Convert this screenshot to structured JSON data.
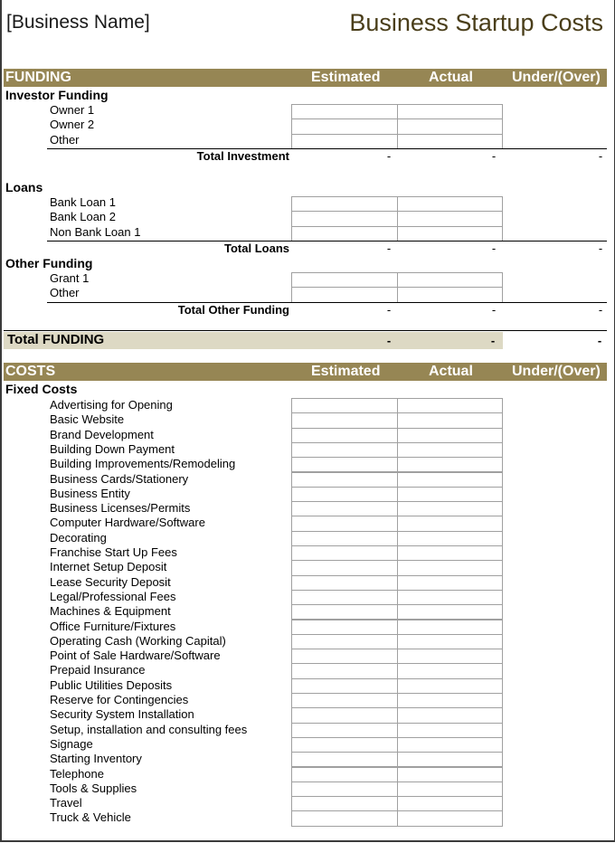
{
  "header": {
    "business_name": "[Business Name]",
    "title": "Business Startup Costs"
  },
  "columns": {
    "estimated": "Estimated",
    "actual": "Actual",
    "under_over": "Under/(Over)"
  },
  "colors": {
    "header_bar": "#968654",
    "total_band": "#ddd9c4",
    "title_text": "#4a3e1a"
  },
  "funding": {
    "section_label": "FUNDING",
    "groups": [
      {
        "label": "Investor Funding",
        "items": [
          "Owner 1",
          "Owner 2",
          "Other"
        ],
        "total_label": "Total Investment",
        "total_values": [
          "-",
          "-",
          "-"
        ]
      },
      {
        "label": "Loans",
        "items": [
          "Bank Loan 1",
          "Bank Loan 2",
          "Non Bank Loan 1"
        ],
        "total_label": "Total Loans",
        "total_values": [
          "-",
          "-",
          "-"
        ]
      },
      {
        "label": "Other Funding",
        "items": [
          "Grant 1",
          "Other"
        ],
        "total_label": "Total Other Funding",
        "total_values": [
          "-",
          "-",
          "-"
        ]
      }
    ],
    "grand_total_label": "Total FUNDING",
    "grand_total_values": [
      "-",
      "-",
      "-"
    ]
  },
  "costs": {
    "section_label": "COSTS",
    "groups": [
      {
        "label": "Fixed Costs",
        "items": [
          "Advertising for Opening",
          "Basic Website",
          "Brand Development",
          "Building Down Payment",
          "Building Improvements/Remodeling",
          "Business Cards/Stationery",
          "Business Entity",
          "Business Licenses/Permits",
          "Computer Hardware/Software",
          "Decorating",
          "Franchise Start Up Fees",
          "Internet Setup Deposit",
          "Lease Security Deposit",
          "Legal/Professional Fees",
          "Machines & Equipment",
          "Office Furniture/Fixtures",
          "Operating Cash (Working Capital)",
          "Point of Sale Hardware/Software",
          "Prepaid Insurance",
          "Public Utilities Deposits",
          "Reserve for Contingencies",
          "Security System Installation",
          "Setup, installation and consulting fees",
          "Signage",
          "Starting Inventory",
          "Telephone",
          "Tools & Supplies",
          "Travel",
          "Truck & Vehicle"
        ]
      }
    ]
  }
}
